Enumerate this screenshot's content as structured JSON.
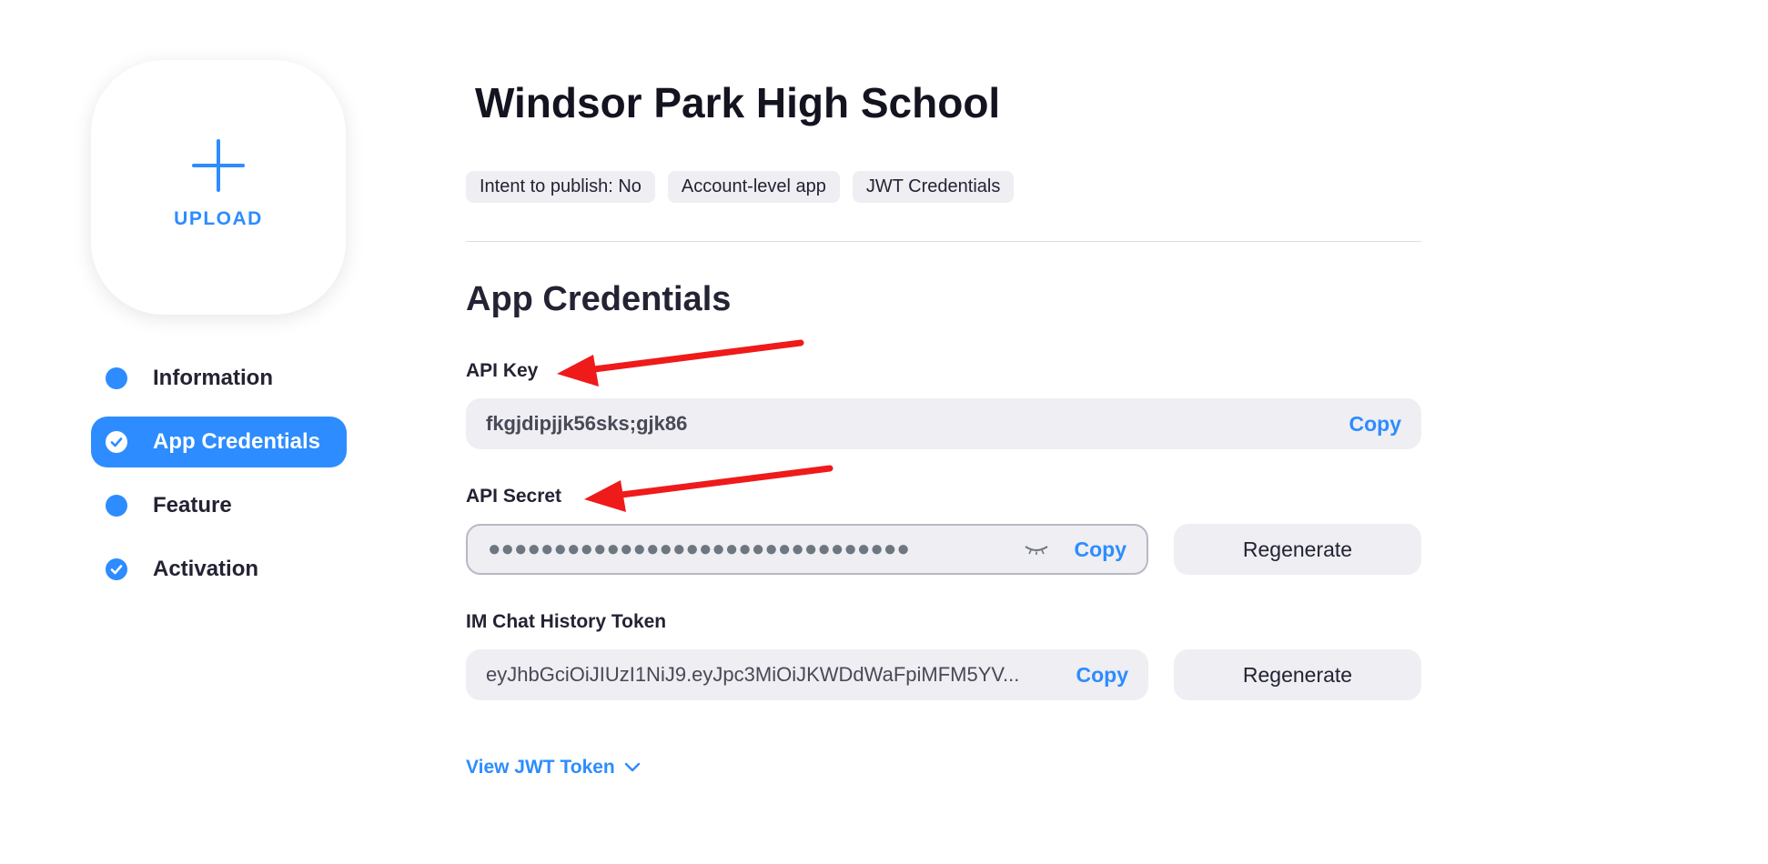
{
  "sidebar": {
    "upload_label": "UPLOAD",
    "items": [
      {
        "label": "Information",
        "icon": "dot-icon",
        "active": false
      },
      {
        "label": "App Credentials",
        "icon": "check-circle-icon",
        "active": true
      },
      {
        "label": "Feature",
        "icon": "dot-icon",
        "active": false
      },
      {
        "label": "Activation",
        "icon": "check-circle-icon",
        "active": false
      }
    ]
  },
  "main": {
    "app_title": "Windsor Park High School",
    "tags": [
      "Intent to publish: No",
      "Account-level app",
      "JWT Credentials"
    ],
    "section_title": "App Credentials",
    "api_key": {
      "label": "API Key",
      "value": "fkgjdipjjk56sks;gjk86",
      "copy_label": "Copy"
    },
    "api_secret": {
      "label": "API Secret",
      "value": "●●●●●●●●●●●●●●●●●●●●●●●●●●●●●●●●",
      "copy_label": "Copy",
      "regenerate_label": "Regenerate"
    },
    "im_token": {
      "label": "IM Chat History Token",
      "value": "eyJhbGciOiJIUzI1NiJ9.eyJpc3MiOiJKWDdWaFpiMFM5YV...",
      "copy_label": "Copy",
      "regenerate_label": "Regenerate"
    },
    "view_jwt_label": "View JWT Token"
  },
  "colors": {
    "accent": "#2d8cff",
    "annotation_arrow": "#ef1a1a",
    "field_bg": "#eeeef3"
  }
}
